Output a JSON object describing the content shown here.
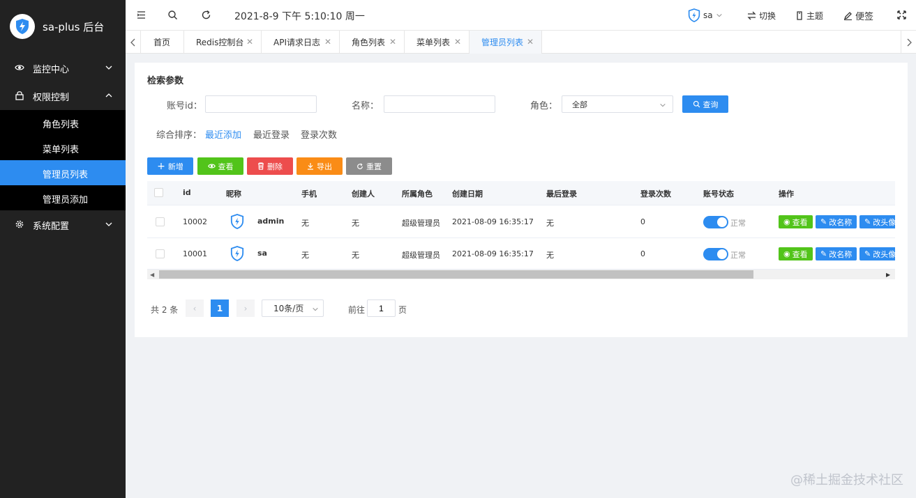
{
  "sidebar": {
    "title": "sa-plus 后台",
    "menus": [
      {
        "label": "监控中心",
        "icon": "eye-icon"
      },
      {
        "label": "权限控制",
        "icon": "lock-icon"
      },
      {
        "label": "系统配置",
        "icon": "gear-icon"
      }
    ],
    "submenus": [
      "角色列表",
      "菜单列表",
      "管理员列表",
      "管理员添加"
    ],
    "active_submenu": "管理员列表"
  },
  "topbar": {
    "datetime": "2021-8-9 下午 5:10:10 周一",
    "user": "sa",
    "switch_label": "切换",
    "theme_label": "主题",
    "note_label": "便签"
  },
  "tabs": [
    {
      "label": "首页",
      "closable": false
    },
    {
      "label": "Redis控制台",
      "closable": true
    },
    {
      "label": "API请求日志",
      "closable": true
    },
    {
      "label": "角色列表",
      "closable": true
    },
    {
      "label": "菜单列表",
      "closable": true
    },
    {
      "label": "管理员列表",
      "closable": true,
      "active": true
    }
  ],
  "search": {
    "title": "检索参数",
    "account_id_label": "账号id：",
    "name_label": "名称：",
    "role_label": "角色：",
    "role_value": "全部",
    "query_label": "查询",
    "sort_label": "综合排序：",
    "sort_options": [
      "最近添加",
      "最近登录",
      "登录次数"
    ],
    "active_sort": "最近添加"
  },
  "actions": {
    "add": "新增",
    "view": "查看",
    "delete": "删除",
    "export": "导出",
    "reset": "重置"
  },
  "table": {
    "headers": [
      "id",
      "昵称",
      "手机",
      "创建人",
      "所属角色",
      "创建日期",
      "最后登录",
      "登录次数",
      "账号状态",
      "操作"
    ],
    "rows": [
      {
        "id": "10002",
        "name": "admin",
        "phone": "无",
        "creator": "无",
        "role": "超级管理员",
        "created": "2021-08-09 16:35:17",
        "last_login": "无",
        "login_count": "0",
        "status": "正常",
        "enabled": true
      },
      {
        "id": "10001",
        "name": "sa",
        "phone": "无",
        "creator": "无",
        "role": "超级管理员",
        "created": "2021-08-09 16:35:17",
        "last_login": "无",
        "login_count": "0",
        "status": "正常",
        "enabled": true
      }
    ],
    "op_view": "查看",
    "op_rename": "改名称",
    "op_avatar": "改头像"
  },
  "pagination": {
    "total": "共 2 条",
    "current": "1",
    "page_size": "10条/页",
    "goto_label": "前往",
    "goto_value": "1",
    "page_suffix": "页"
  },
  "watermark": "@稀土掘金技术社区",
  "colors": {
    "primary": "#2d8cf0",
    "success": "#52c41a",
    "danger": "#ed4d4d",
    "warning": "#fa8c16",
    "neutral": "#8c8c8c",
    "sidebar": "#222222"
  }
}
